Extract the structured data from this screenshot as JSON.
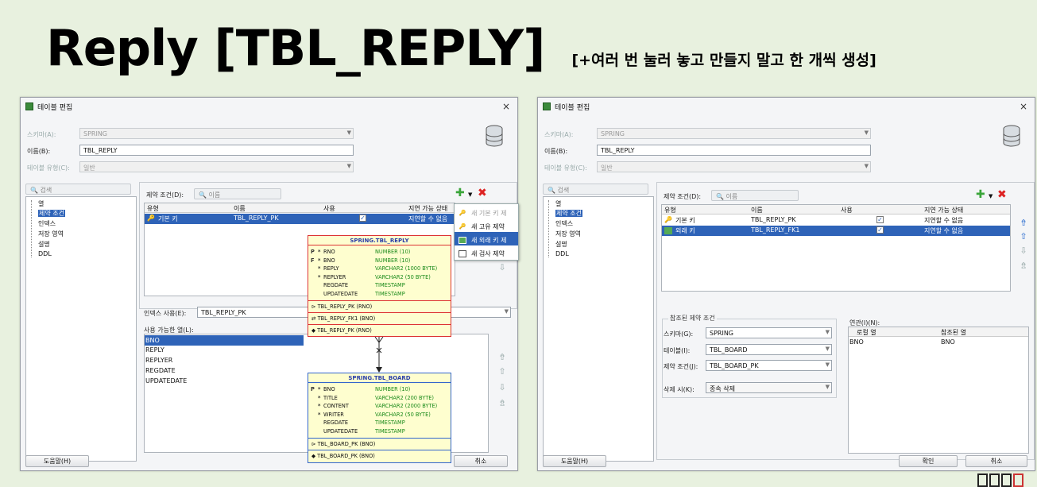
{
  "slide": {
    "title": "Reply [TBL_REPLY]",
    "subtitle": "[+여러 번 눌러 놓고 만들지 말고 한 개씩 생성]"
  },
  "dialog_title": "테이블 편집",
  "close_glyph": "×",
  "form": {
    "schema_label": "스키마(A):",
    "schema_value": "SPRING",
    "name_label": "이름(B):",
    "name_value": "TBL_REPLY",
    "type_label": "테이블 유형(C):",
    "type_value": "일반"
  },
  "search_placeholder": "검색",
  "tree": [
    "열",
    "제약 조건",
    "인덱스",
    "저장 영역",
    "설명",
    "DDL"
  ],
  "constraints": {
    "label": "제약 조건(D):",
    "search_placeholder": "이름",
    "columns": [
      "유형",
      "이름",
      "사용",
      "지연 가능 상태"
    ]
  },
  "left": {
    "rows": [
      {
        "type": "기본 키",
        "name": "TBL_REPLY_PK",
        "used": true,
        "deferrable": "지연할 수 없음"
      }
    ],
    "menu": [
      "새 기본 키 제",
      "새 고유 제약",
      "새 외래 키 제",
      "새 검사 제약"
    ],
    "index_label": "인덱스 사용(E):",
    "index_value": "TBL_REPLY_PK",
    "usable_cols_label": "사용 가능한 열(L):",
    "usable_cols": [
      "BNO",
      "REPLY",
      "REPLYER",
      "REGDATE",
      "UPDATEDATE"
    ],
    "help": "도움말(H)",
    "cancel": "취소",
    "erd_reply": {
      "title": "SPRING.TBL_REPLY",
      "cols": [
        {
          "k": "P",
          "s": "*",
          "n": "RNO",
          "t": "NUMBER (10)"
        },
        {
          "k": "F",
          "s": "*",
          "n": "BNO",
          "t": "NUMBER (10)"
        },
        {
          "k": "",
          "s": "*",
          "n": "REPLY",
          "t": "VARCHAR2 (1000 BYTE)"
        },
        {
          "k": "",
          "s": "*",
          "n": "REPLYER",
          "t": "VARCHAR2 (50 BYTE)"
        },
        {
          "k": "",
          "s": "",
          "n": "REGDATE",
          "t": "TIMESTAMP"
        },
        {
          "k": "",
          "s": "",
          "n": "UPDATEDATE",
          "t": "TIMESTAMP"
        }
      ],
      "keys": [
        "TBL_REPLY_PK (RNO)",
        "TBL_REPLY_FK1 (BNO)",
        "TBL_REPLY_PK (RNO)"
      ]
    },
    "erd_board": {
      "title": "SPRING.TBL_BOARD",
      "cols": [
        {
          "k": "P",
          "s": "*",
          "n": "BNO",
          "t": "NUMBER (10)"
        },
        {
          "k": "",
          "s": "*",
          "n": "TITLE",
          "t": "VARCHAR2 (200 BYTE)"
        },
        {
          "k": "",
          "s": "*",
          "n": "CONTENT",
          "t": "VARCHAR2 (2000 BYTE)"
        },
        {
          "k": "",
          "s": "*",
          "n": "WRITER",
          "t": "VARCHAR2 (50 BYTE)"
        },
        {
          "k": "",
          "s": "",
          "n": "REGDATE",
          "t": "TIMESTAMP"
        },
        {
          "k": "",
          "s": "",
          "n": "UPDATEDATE",
          "t": "TIMESTAMP"
        }
      ],
      "keys": [
        "TBL_BOARD_PK (BNO)",
        "TBL_BOARD_PK (BNO)"
      ]
    }
  },
  "right": {
    "rows": [
      {
        "type": "기본 키",
        "name": "TBL_REPLY_PK",
        "used": true,
        "deferrable": "지연할 수 없음"
      },
      {
        "type": "외래 키",
        "name": "TBL_REPLY_FK1",
        "used": true,
        "deferrable": "지연할 수 없음"
      }
    ],
    "ref_group": "참조된 제약 조건",
    "ref_schema_label": "스키마(G):",
    "ref_schema": "SPRING",
    "ref_table_label": "테이블(I):",
    "ref_table": "TBL_BOARD",
    "ref_cons_label": "제약 조건(J):",
    "ref_cons": "TBL_BOARD_PK",
    "on_delete_label": "삭제 시(K):",
    "on_delete": "종속 삭제",
    "assoc_label": "연관(I)(N):",
    "assoc_cols": [
      "로컬 열",
      "참조된 열"
    ],
    "assoc_row": [
      "BNO",
      "BNO"
    ],
    "help": "도움말(H)",
    "ok": "확인",
    "cancel": "취소"
  },
  "colors": {
    "accent": "#2e63b8",
    "background": "#e8f1df",
    "erd_border": "#dd3333",
    "erd_fill": "#fefecf"
  }
}
